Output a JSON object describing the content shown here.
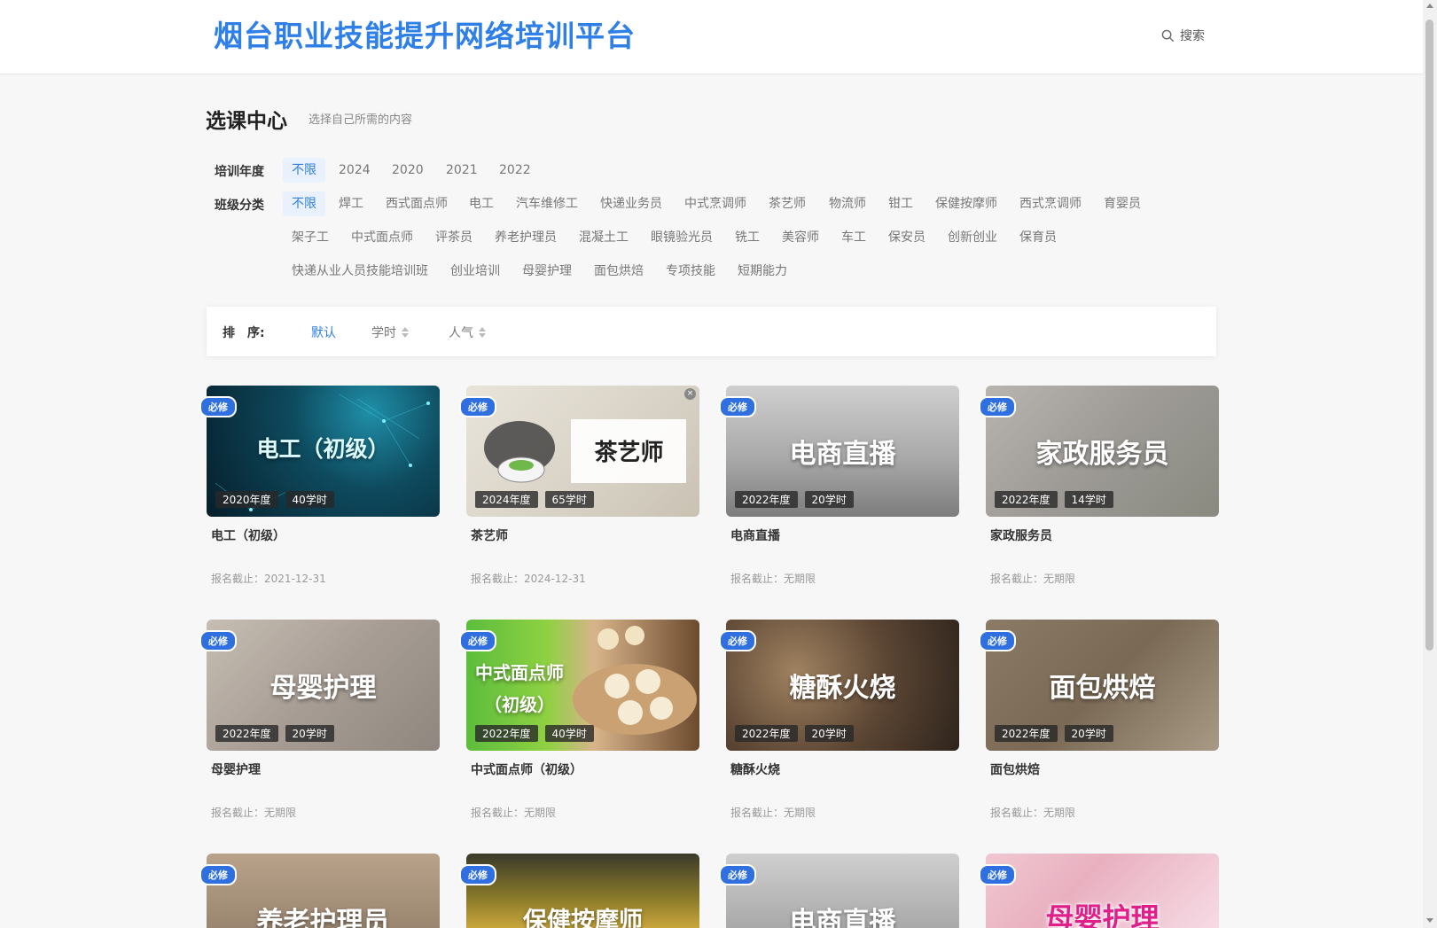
{
  "header": {
    "site_title": "烟台职业技能提升网络培训平台",
    "search_label": "搜索"
  },
  "section": {
    "title": "选课中心",
    "subtitle": "选择自己所需的内容"
  },
  "filters": {
    "year_label": "培训年度",
    "years": [
      "不限",
      "2024",
      "2020",
      "2021",
      "2022"
    ],
    "year_selected": "不限",
    "category_label": "班级分类",
    "categories_row1": [
      "不限",
      "焊工",
      "西式面点师",
      "电工",
      "汽车维修工",
      "快递业务员",
      "中式烹调师",
      "茶艺师",
      "物流师",
      "钳工",
      "保健按摩师",
      "西式烹调师",
      "育婴员"
    ],
    "categories_row2": [
      "架子工",
      "中式面点师",
      "评茶员",
      "养老护理员",
      "混凝土工",
      "眼镜验光员",
      "铣工",
      "美容师",
      "车工",
      "保安员",
      "创新创业",
      "保育员"
    ],
    "categories_row3": [
      "快递从业人员技能培训班",
      "创业培训",
      "母婴护理",
      "面包烘焙",
      "专项技能",
      "短期能力"
    ],
    "category_selected": "不限"
  },
  "sort": {
    "label": "排　序:",
    "options": [
      "默认",
      "学时",
      "人气"
    ],
    "selected": "默认"
  },
  "courses": [
    {
      "thumb_text": "电工（初级）",
      "badge": "必修",
      "year": "2020年度",
      "hours": "40学时",
      "title": "电工（初级）",
      "deadline": "报名截止：2021-12-31"
    },
    {
      "thumb_text": "茶艺师",
      "badge": "必修",
      "year": "2024年度",
      "hours": "65学时",
      "title": "茶艺师",
      "deadline": "报名截止：2024-12-31"
    },
    {
      "thumb_text": "电商直播",
      "badge": "必修",
      "year": "2022年度",
      "hours": "20学时",
      "title": "电商直播",
      "deadline": "报名截止：无期限"
    },
    {
      "thumb_text": "家政服务员",
      "badge": "必修",
      "year": "2022年度",
      "hours": "14学时",
      "title": "家政服务员",
      "deadline": "报名截止：无期限"
    },
    {
      "thumb_text": "母婴护理",
      "badge": "必修",
      "year": "2022年度",
      "hours": "20学时",
      "title": "母婴护理",
      "deadline": "报名截止：无期限"
    },
    {
      "thumb_text": "中式面点师",
      "thumb_text2": "（初级）",
      "badge": "必修",
      "year": "2022年度",
      "hours": "40学时",
      "title": "中式面点师（初级）",
      "deadline": "报名截止：无期限"
    },
    {
      "thumb_text": "糖酥火烧",
      "badge": "必修",
      "year": "2022年度",
      "hours": "20学时",
      "title": "糖酥火烧",
      "deadline": "报名截止：无期限"
    },
    {
      "thumb_text": "面包烘焙",
      "badge": "必修",
      "year": "2022年度",
      "hours": "20学时",
      "title": "面包烘焙",
      "deadline": "报名截止：无期限"
    },
    {
      "thumb_text": "养老护理员",
      "badge": "必修"
    },
    {
      "thumb_text": "保健按摩师",
      "badge": "必修"
    },
    {
      "thumb_text": "电商直播",
      "badge": "必修"
    },
    {
      "thumb_text": "母婴护理",
      "badge": "必修"
    }
  ],
  "colors": {
    "accent": "#2f7fe8",
    "badge": "#2f6fe0"
  }
}
